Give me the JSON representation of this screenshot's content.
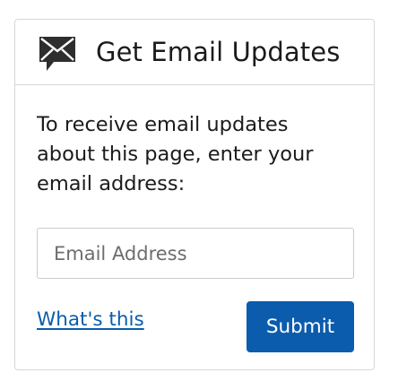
{
  "widget": {
    "title": "Get Email Updates",
    "header_icon": "email-speech-bubble-icon",
    "intro_text": "To receive email updates about this page, enter your email address:",
    "email_input": {
      "placeholder": "Email Address",
      "value": ""
    },
    "whats_this_link": "What's this",
    "submit_label": "Submit"
  },
  "colors": {
    "accent": "#0b5cad",
    "border": "#d6d7d9",
    "text": "#1b1b1b",
    "icon": "#2e2e2e"
  }
}
